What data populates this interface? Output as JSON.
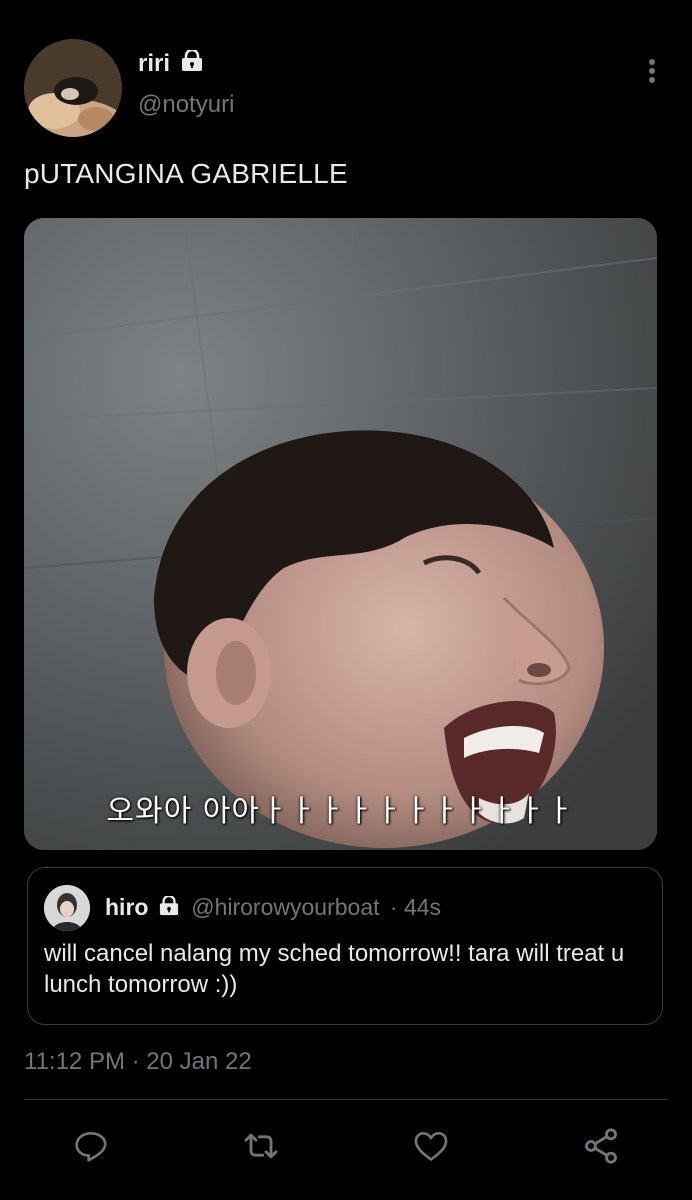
{
  "author": {
    "name": "riri",
    "handle": "@notyuri"
  },
  "tweet": {
    "text": "pUTANGINA GABRIELLE",
    "media_caption": "오와아 아아ㅏㅏㅏㅏㅏㅏㅏㅏㅏㅏㅏ"
  },
  "quote": {
    "name": "hiro",
    "handle": "@hirorowyourboat",
    "time": "· 44s",
    "text": "will cancel nalang my sched tomorrow!! tara will treat u lunch tomorrow :))"
  },
  "timestamp": "11:12 PM · 20 Jan 22",
  "icons": {
    "lock": "lock-icon",
    "more": "more-vertical-icon",
    "reply": "reply-icon",
    "retweet": "retweet-icon",
    "like": "heart-icon",
    "share": "share-icon"
  },
  "colors": {
    "background": "#000000",
    "text": "#e7e9ea",
    "muted": "#71767b",
    "border": "#2f3336"
  }
}
